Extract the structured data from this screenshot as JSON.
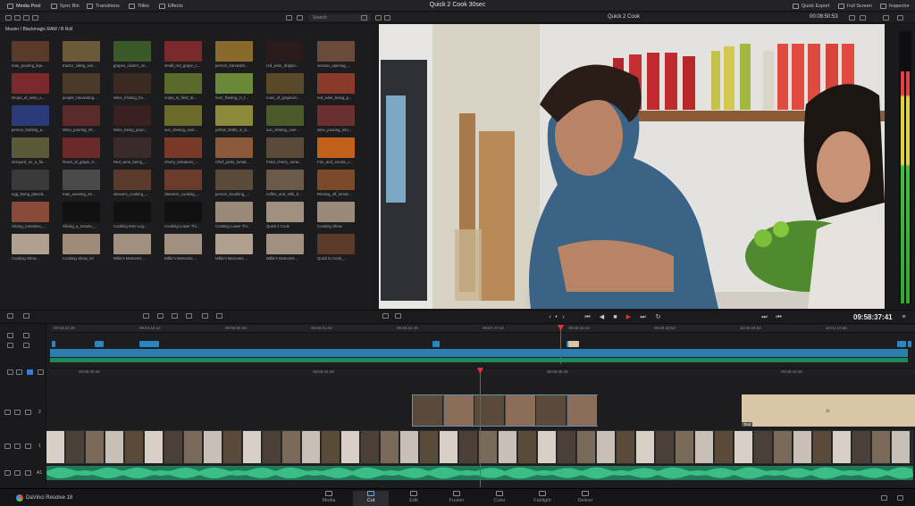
{
  "topbar": {
    "media_pool": "Media Pool",
    "sync_bin": "Sync Bin",
    "transitions": "Transitions",
    "titles": "Titles",
    "effects": "Effects",
    "project_title": "Quick 2 Cook 30sec",
    "quick_export": "Quick Export",
    "full_screen": "Full Screen",
    "inspector": "Inspector"
  },
  "toolbar2": {
    "search_placeholder": "Search",
    "viewer_clip": "Quick 2 Cook",
    "timecode": "00:08:50:53"
  },
  "mediapool": {
    "breadcrumb": "Master / Blackmagic RAW / B Roll",
    "clips": [
      "man_pouring_liqu...",
      "tractor_riding_ove...",
      "grapes_cluster_on...",
      "small_red_grape_c...",
      "person_harvestin...",
      "red_wine_drippin...",
      "woman_opening_...",
      "Drops_of_wine_o...",
      "people_harvesting...",
      "Wine_tricking_fro...",
      "crops_in_field_at...",
      "river_flowing_in_f...",
      "rows_of_grapevin...",
      "red_wine_being_p...",
      "person_holding_a...",
      "Wine_pouring_int...",
      "Wine_being_pouri...",
      "sun_shining_over...",
      "yellow_fields_in_b...",
      "sun_shining_over...",
      "wine_pouring_into...",
      "vineyard_on_a_fie...",
      "Rows_of_grape_tr...",
      "Red_wine_being_...",
      "cherry_tomatoes_...",
      "Chef_picks_tomat...",
      "Fried_cherry_toma...",
      "Fire_and_smoke_c...",
      "egg_being_placed...",
      "man_wearing_an...",
      "skewers_cooking_...",
      "Skewers_cooking_...",
      "person_brushing_...",
      "coffee_and_milk_b...",
      "Slicing_tomatoes_...",
      "Slicing_a_tomato_...",
      "Cooking Intro Log...",
      "Cooking Lower Thi...",
      "Cooking Lower Thi...",
      "Quick 2 Cook",
      "Cooking Show",
      "Cooking Show...",
      "Cooking Show_int",
      "Millie's Moments ...",
      "Millie's Moments ...",
      "Millie's Moments ...",
      "Millie's Moments ...",
      "Quick to Cook_..."
    ],
    "extra_clip": "Rinsing_off_tomat..."
  },
  "viewer": {
    "timecode": "09:58:37:41"
  },
  "timeline": {
    "ruler1": [
      "09:53:22:28",
      "09:54:15:12",
      "09:55:08:36",
      "09:56:01:40",
      "09:56:54:49",
      "09:57:47:44",
      "09:58:40:44",
      "09:59:33:52",
      "10:00:26:52",
      "10:01:15:56"
    ],
    "ruler2": [
      "09:58:30:48",
      "09:58:34:48",
      "09:58:38:48",
      "09:58:42:48"
    ],
    "title_clip_label": "Text",
    "tracks": [
      "2",
      "1",
      "A1"
    ]
  },
  "pages": [
    "Media",
    "Cut",
    "Edit",
    "Fusion",
    "Color",
    "Fairlight",
    "Deliver"
  ],
  "active_page": "Cut",
  "brand": "DaVinci Resolve 18",
  "colors": {
    "accent": "#e0303a",
    "clip_blue": "#2a7fb0",
    "audio_green": "#1f7a55"
  }
}
